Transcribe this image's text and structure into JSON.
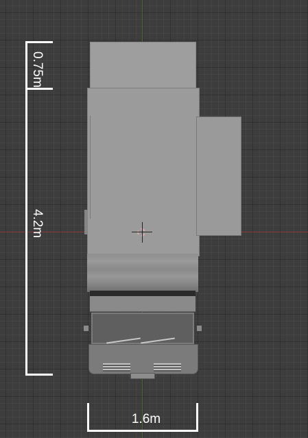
{
  "viewport": {
    "grid_color": "#3d3d3d",
    "x_axis_color": "#8b3a3a",
    "y_axis_color": "#4d6b2e"
  },
  "dimensions": {
    "cab_length": "0.75m",
    "body_length": "4.2m",
    "width": "1.6m",
    "line_color": "#ffffff"
  },
  "model": {
    "type": "truck top view",
    "body_color": "#9b9b9b"
  },
  "cursor": {
    "icon": "3d-cursor-icon"
  }
}
